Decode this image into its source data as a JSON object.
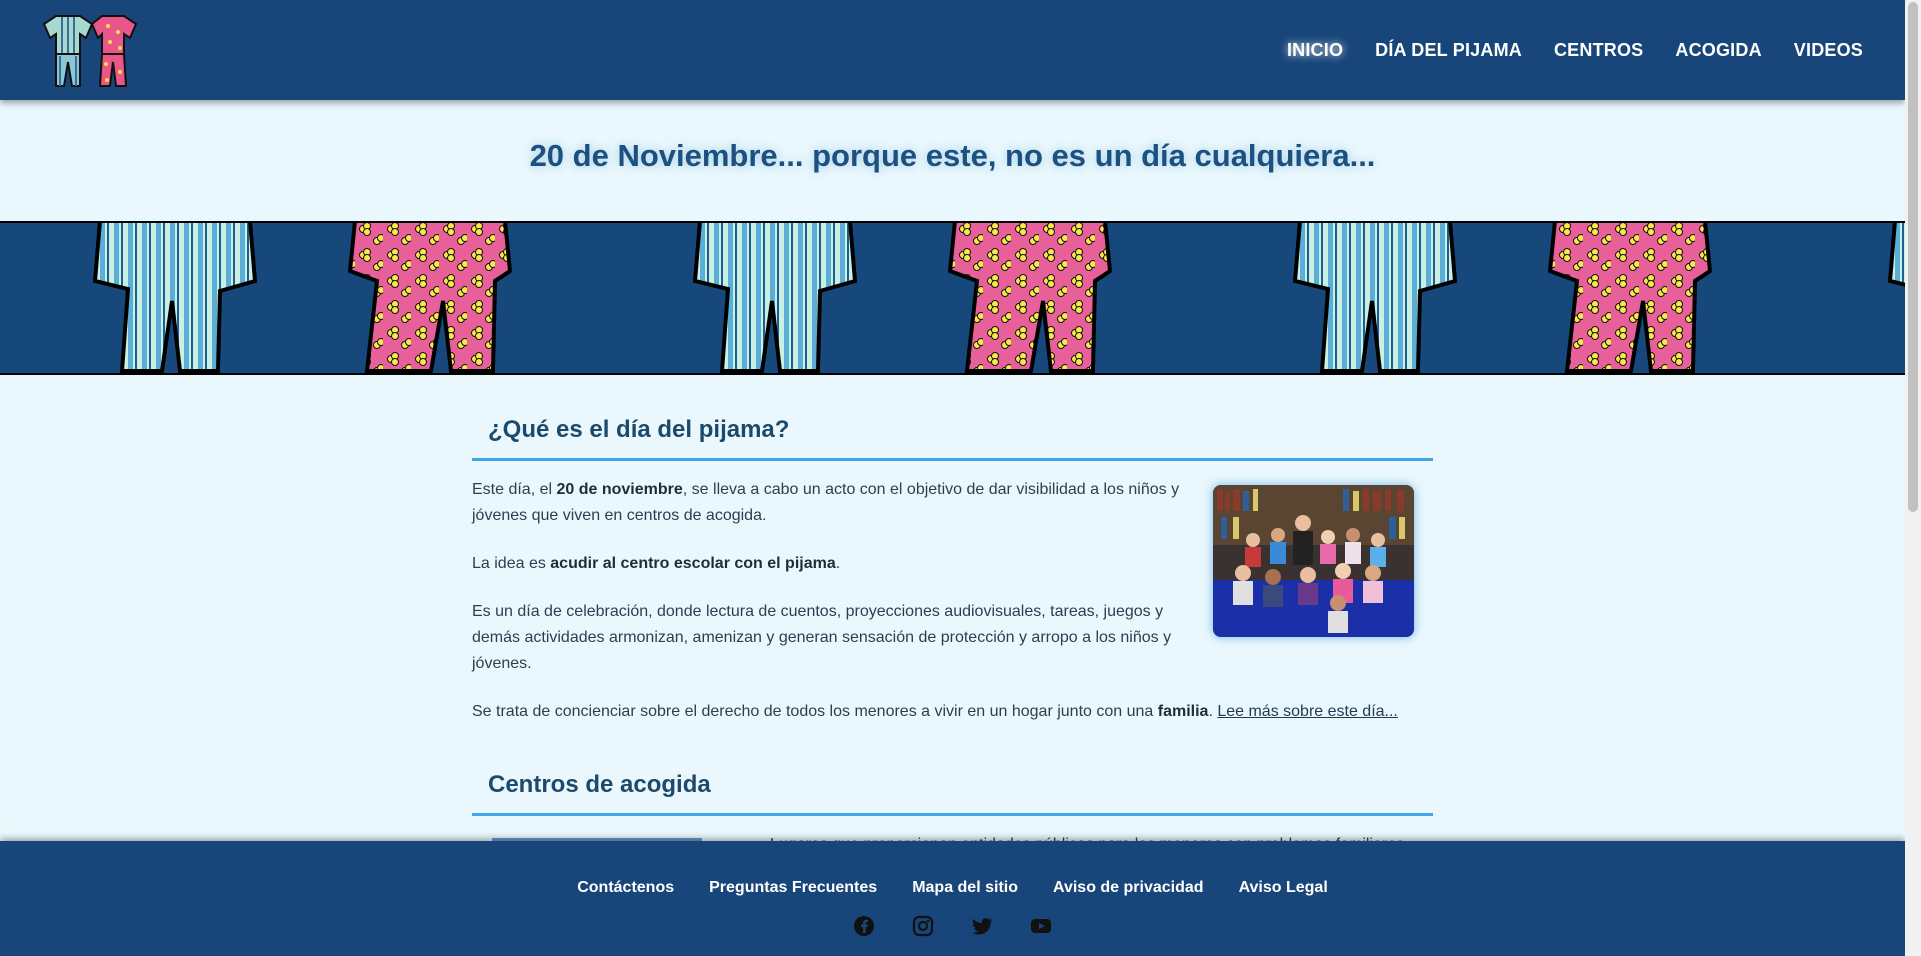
{
  "nav": {
    "items": [
      {
        "label": "INICIO",
        "active": true
      },
      {
        "label": "DÍA DEL PIJAMA"
      },
      {
        "label": "CENTROS"
      },
      {
        "label": "ACOGIDA"
      },
      {
        "label": "VIDEOS"
      }
    ]
  },
  "hero": {
    "title": "20 de Noviembre... porque este, no es un día cualquiera..."
  },
  "section1": {
    "heading": "¿Qué es el día del pijama?",
    "p1_a": "Este día, el ",
    "p1_b": "20 de noviembre",
    "p1_c": ", se lleva a cabo un acto con el objetivo de dar visibilidad a los niños y jóvenes que viven en centros de acogida.",
    "p2_a": "La idea es ",
    "p2_b": "acudir al centro escolar con el pijama",
    "p2_c": ".",
    "p3": "Es un día de celebración, donde lectura de cuentos, proyecciones audiovisuales, tareas, juegos y demás actividades armonizan, amenizan y generan sensación de protección y arropo a los niños y jóvenes.",
    "p4_a": "Se trata de concienciar sobre el derecho de todos los menores a vivir en un hogar junto con una ",
    "p4_b": "familia",
    "p4_c": ". ",
    "read_more": "Lee más sobre este día..."
  },
  "section2": {
    "heading": "Centros de acogida",
    "peek": "Lugares que proporcionan entidades públicas para los menores con problemas familiares"
  },
  "footer": {
    "links": [
      "Contáctenos",
      "Preguntas Frecuentes",
      "Mapa del sitio",
      "Aviso de privacidad",
      "Aviso Legal"
    ],
    "social": [
      "facebook-icon",
      "instagram-icon",
      "twitter-icon",
      "youtube-icon"
    ]
  },
  "colors": {
    "header": "#18467a",
    "background": "#eaf8fd",
    "accent": "#3fa7e8",
    "title": "#1c5080"
  }
}
